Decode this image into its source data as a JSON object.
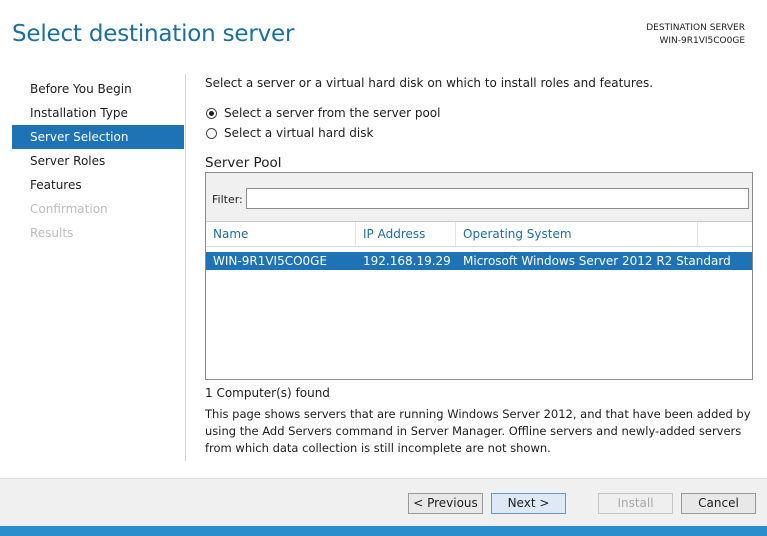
{
  "header": {
    "title": "Select destination server",
    "destination_label": "DESTINATION SERVER",
    "destination_value": "WIN-9R1VI5CO0GE"
  },
  "nav": {
    "items": [
      {
        "label": "Before You Begin",
        "state": "normal"
      },
      {
        "label": "Installation Type",
        "state": "normal"
      },
      {
        "label": "Server Selection",
        "state": "active"
      },
      {
        "label": "Server Roles",
        "state": "normal"
      },
      {
        "label": "Features",
        "state": "normal"
      },
      {
        "label": "Confirmation",
        "state": "disabled"
      },
      {
        "label": "Results",
        "state": "disabled"
      }
    ]
  },
  "main": {
    "intro": "Select a server or a virtual hard disk on which to install roles and features.",
    "options": [
      {
        "label": "Select a server from the server pool",
        "checked": true
      },
      {
        "label": "Select a virtual hard disk",
        "checked": false
      }
    ],
    "pool_title": "Server Pool",
    "filter_label": "Filter:",
    "filter_value": "",
    "columns": [
      "Name",
      "IP Address",
      "Operating System"
    ],
    "rows": [
      {
        "name": "WIN-9R1VI5CO0GE",
        "ip": "192.168.19.29",
        "os": "Microsoft Windows Server 2012 R2 Standard"
      }
    ],
    "found_text": "1 Computer(s) found",
    "info_text": "This page shows servers that are running Windows Server 2012, and that have been added by using the Add Servers command in Server Manager. Offline servers and newly-added servers from which data collection is still incomplete are not shown."
  },
  "footer": {
    "previous": "< Previous",
    "next": "Next >",
    "install": "Install",
    "cancel": "Cancel"
  },
  "colors": {
    "accent": "#1e73b7",
    "title": "#1b6e9e",
    "bottom_bar": "#2b8dcb"
  }
}
